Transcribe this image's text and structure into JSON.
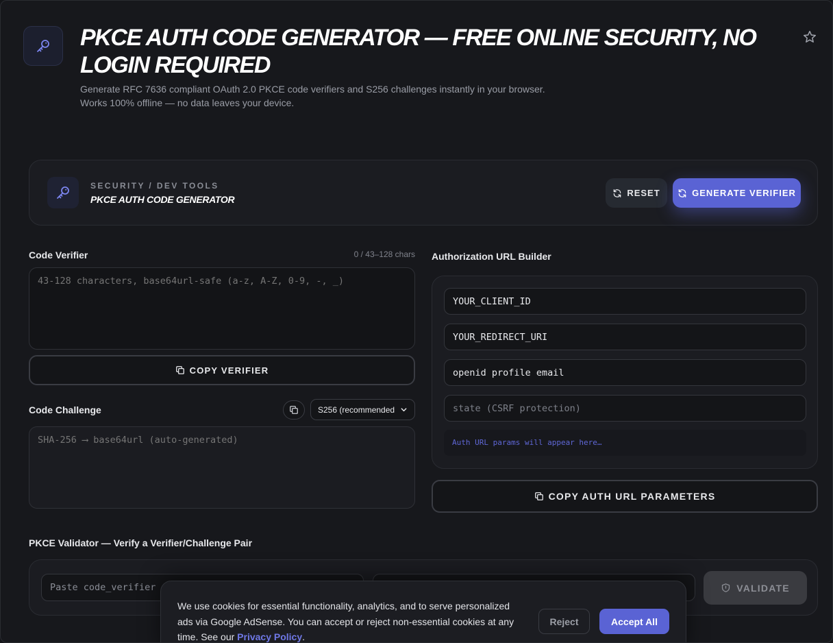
{
  "header": {
    "title": "PKCE AUTH CODE GENERATOR — FREE ONLINE SECURITY, NO LOGIN REQUIRED",
    "subtitle": "Generate RFC 7636 compliant OAuth 2.0 PKCE code verifiers and S256 challenges instantly in your browser. Works 100% offline — no data leaves your device."
  },
  "tool": {
    "category": "SECURITY / DEV TOOLS",
    "name": "PKCE AUTH CODE GENERATOR",
    "reset_label": "RESET",
    "generate_label": "GENERATE VERIFIER"
  },
  "verifier": {
    "label": "Code Verifier",
    "char_count": "0 / 43–128 chars",
    "placeholder": "43-128 characters, base64url-safe (a-z, A-Z, 0-9, -, _)",
    "copy_label": "COPY VERIFIER"
  },
  "challenge": {
    "label": "Code Challenge",
    "method_selected": "S256 (recommended",
    "placeholder": "SHA-256 ⟶ base64url (auto-generated)"
  },
  "url_builder": {
    "label": "Authorization URL Builder",
    "client_id": "YOUR_CLIENT_ID",
    "redirect_uri": "YOUR_REDIRECT_URI",
    "scope": "openid profile email",
    "state_placeholder": "state (CSRF protection)",
    "output_placeholder": "Auth URL params will appear here…",
    "copy_label": "COPY AUTH URL PARAMETERS"
  },
  "validator": {
    "label": "PKCE Validator — Verify a Verifier/Challenge Pair",
    "verifier_placeholder": "Paste code_verifier",
    "challenge_placeholder": "",
    "validate_label": "VALIDATE"
  },
  "cookie": {
    "text": "We use cookies for essential functionality, analytics, and to serve personalized ads via Google AdSense. You can accept or reject non-essential cookies at any time. See our ",
    "link": "Privacy Policy",
    "period": ".",
    "reject_label": "Reject",
    "accept_label": "Accept All"
  },
  "colors": {
    "accent": "#5a63d4",
    "background": "#17181c",
    "link": "#6f78e6"
  },
  "icons": [
    "key-icon",
    "star-icon",
    "refresh-icon",
    "copy-icon",
    "chevron-down-icon",
    "shield-icon"
  ]
}
